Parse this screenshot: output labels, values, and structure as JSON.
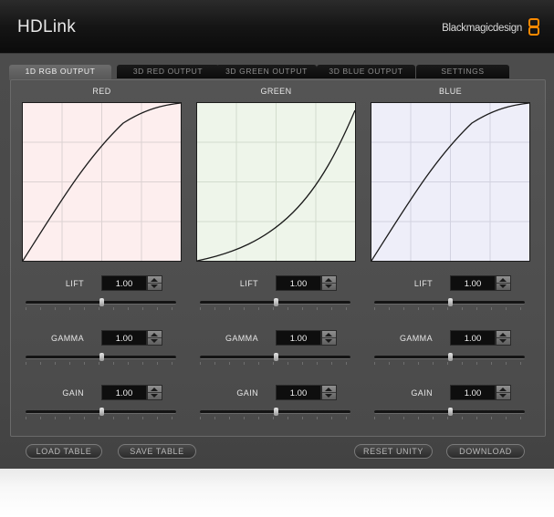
{
  "app": {
    "title": "HDLink",
    "brand": "Blackmagicdesign"
  },
  "tabs": [
    {
      "label": "1D RGB OUTPUT",
      "active": true
    },
    {
      "label": "3D RED OUTPUT",
      "active": false
    },
    {
      "label": "3D GREEN OUTPUT",
      "active": false
    },
    {
      "label": "3D BLUE OUTPUT",
      "active": false
    },
    {
      "label": "SETTINGS",
      "active": false
    }
  ],
  "channels": [
    {
      "name": "RED",
      "bg": "#fdeeee",
      "curve_shape": "concave (log-like)",
      "lift": {
        "label": "LIFT",
        "value": "1.00",
        "slider": 0.5
      },
      "gamma": {
        "label": "GAMMA",
        "value": "1.00",
        "slider": 0.5
      },
      "gain": {
        "label": "GAIN",
        "value": "1.00",
        "slider": 0.5
      }
    },
    {
      "name": "GREEN",
      "bg": "#eef5ea",
      "curve_shape": "convex (exponential-like)",
      "lift": {
        "label": "LIFT",
        "value": "1.00",
        "slider": 0.5
      },
      "gamma": {
        "label": "GAMMA",
        "value": "1.00",
        "slider": 0.5
      },
      "gain": {
        "label": "GAIN",
        "value": "1.00",
        "slider": 0.5
      }
    },
    {
      "name": "BLUE",
      "bg": "#eeeef9",
      "curve_shape": "concave (log-like)",
      "lift": {
        "label": "LIFT",
        "value": "1.00",
        "slider": 0.5
      },
      "gamma": {
        "label": "GAMMA",
        "value": "1.00",
        "slider": 0.5
      },
      "gain": {
        "label": "GAIN",
        "value": "1.00",
        "slider": 0.5
      }
    }
  ],
  "buttons": {
    "load_table": "LOAD TABLE",
    "save_table": "SAVE TABLE",
    "reset_unity": "RESET UNITY",
    "download": "DOWNLOAD"
  },
  "colors": {
    "accent": "#ff8a00",
    "window": "#4a4a4a",
    "titlebar": "#111111"
  }
}
